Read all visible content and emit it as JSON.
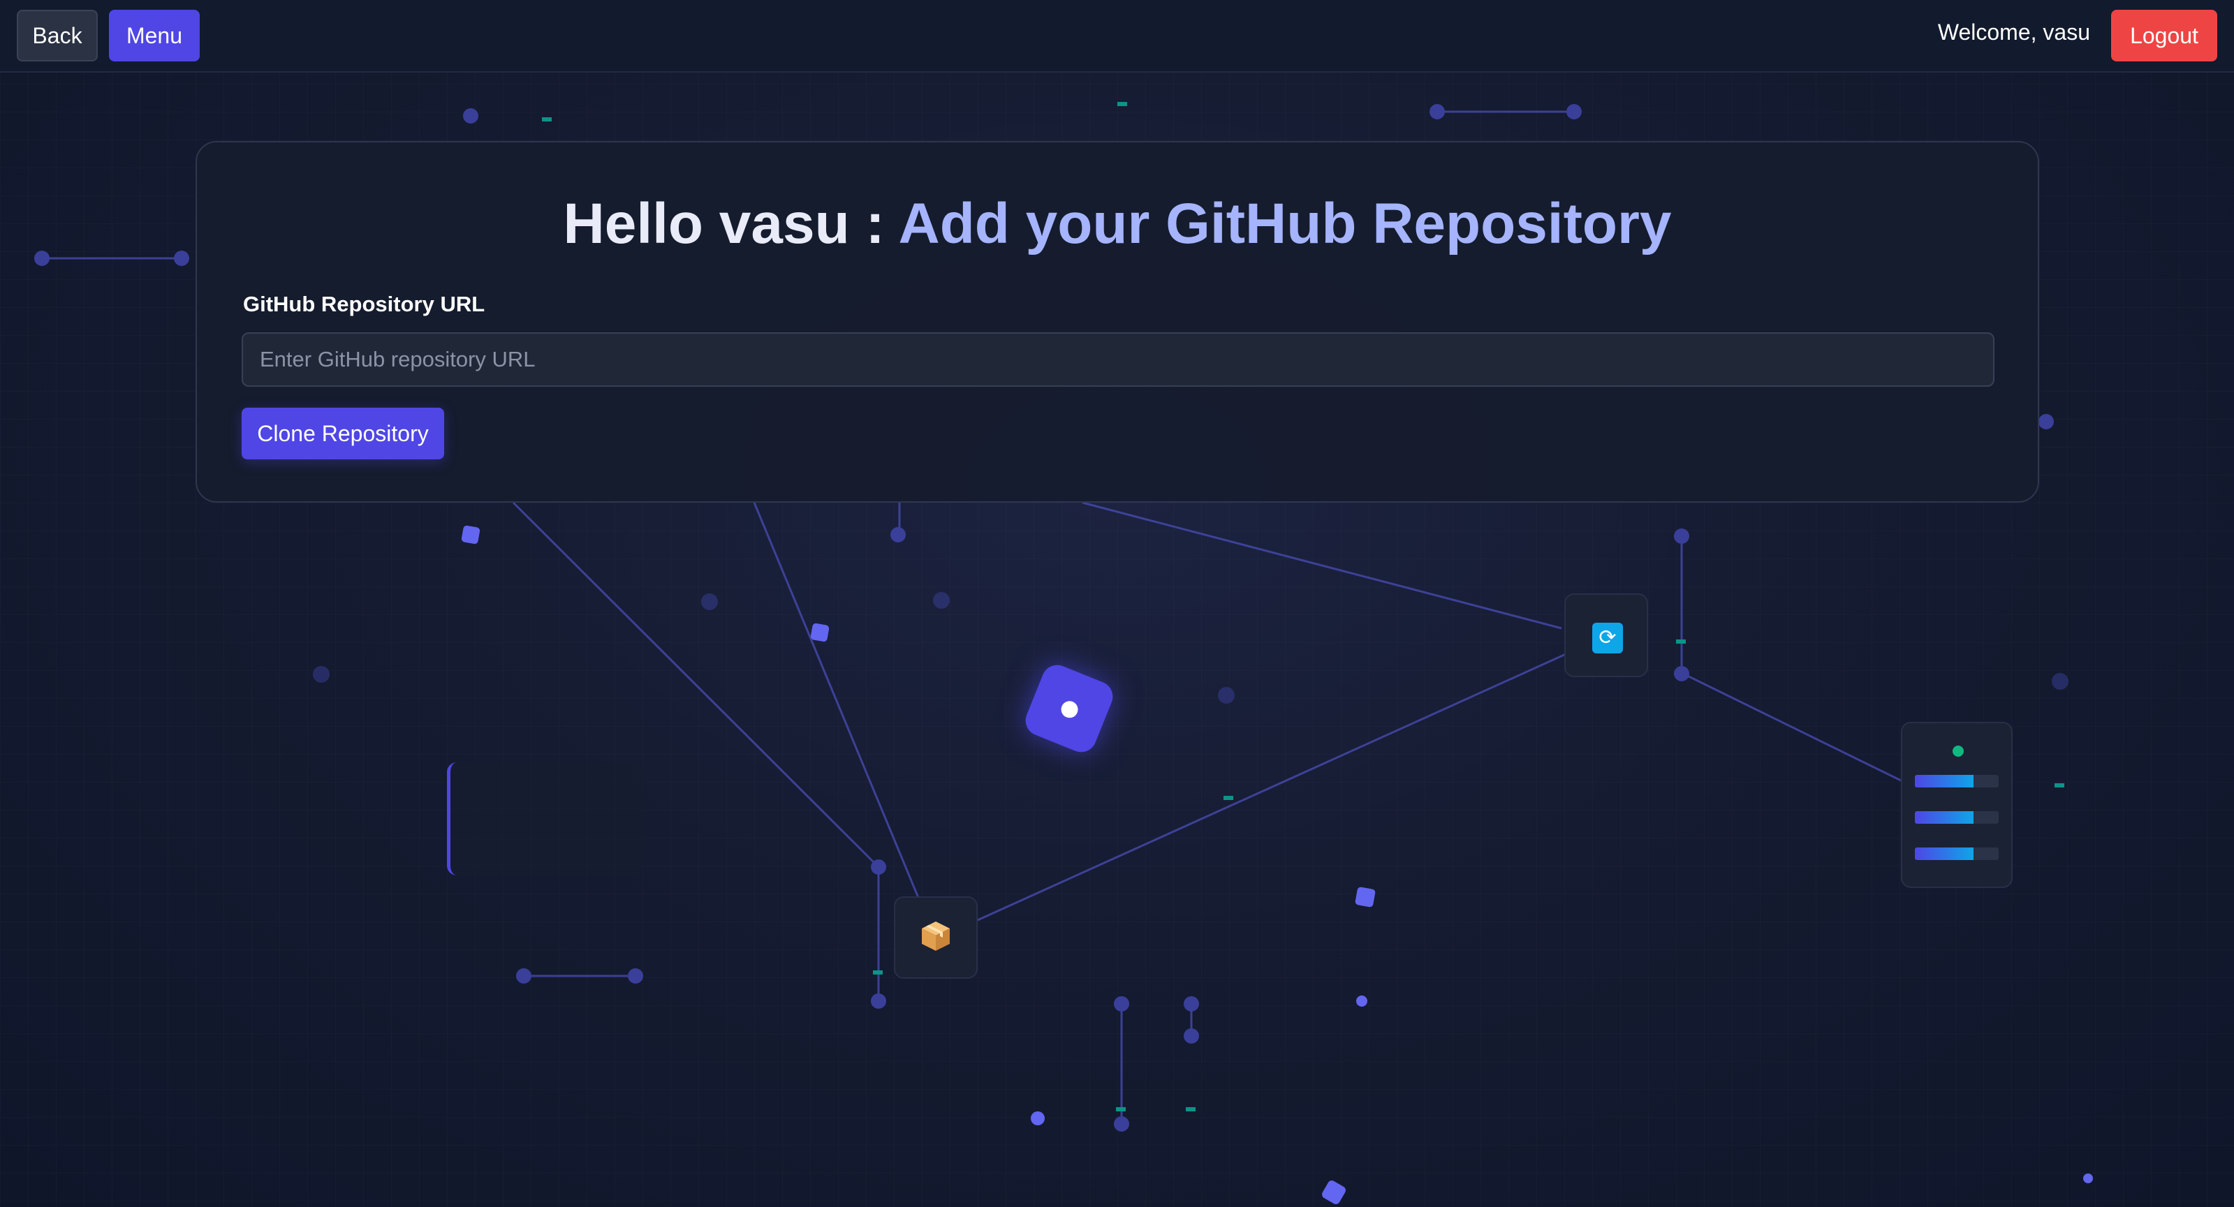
{
  "topbar": {
    "back_label": "Back",
    "menu_label": "Menu",
    "welcome_text": "Welcome, vasu",
    "logout_label": "Logout"
  },
  "card": {
    "title_prefix": "Hello vasu : ",
    "title_accent": "Add your GitHub Repository",
    "field_label": "GitHub Repository URL",
    "url_input_value": "",
    "url_input_placeholder": "Enter GitHub repository URL",
    "clone_button_label": "Clone Repository"
  },
  "widgets": {
    "sync_icon": "sync-icon",
    "package_icon": "package-icon",
    "server_status": "online",
    "server_bars_fill": [
      0.7,
      0.7,
      0.7
    ]
  },
  "colors": {
    "accent": "#4f46e5",
    "accent_light": "#a5b4fc",
    "danger": "#ef4444",
    "background": "#131a2e",
    "status_online": "#10b981",
    "sync_blue": "#0ea5e9"
  }
}
